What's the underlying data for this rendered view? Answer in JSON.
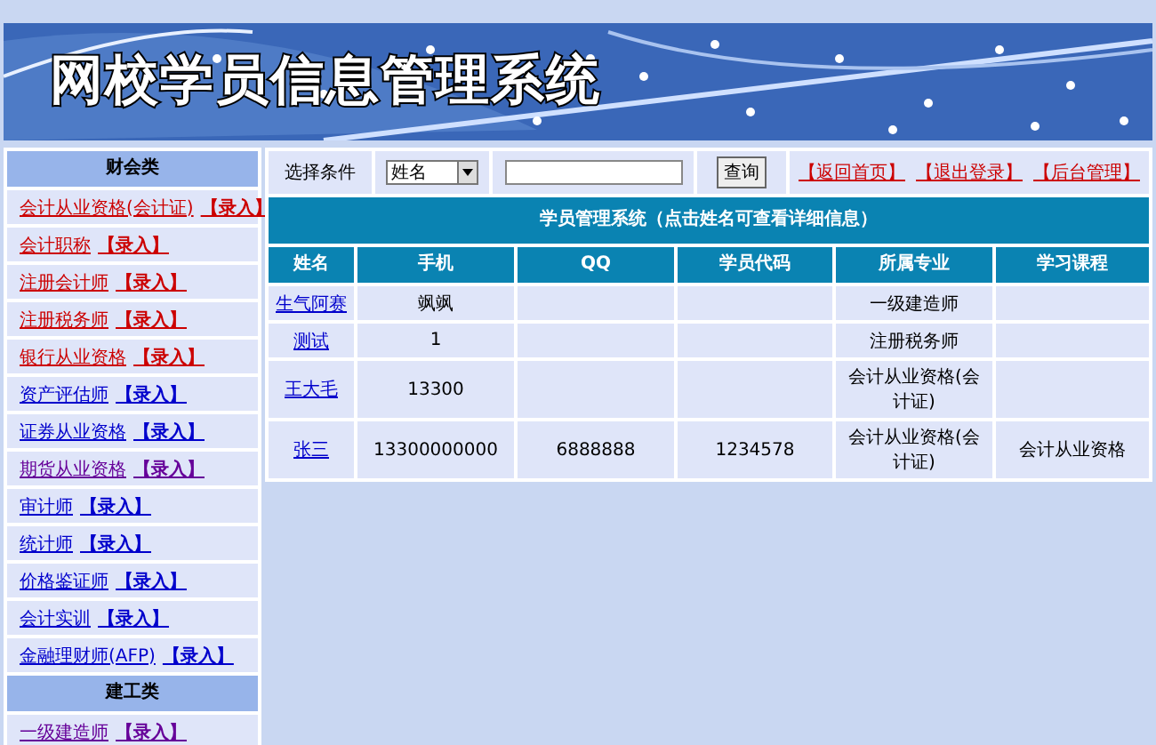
{
  "banner": {
    "title": "网校学员信息管理系统"
  },
  "sidebar": {
    "sections": [
      {
        "heading": "财会类",
        "items": [
          {
            "label": "会计从业资格(会计证)",
            "action": "【录入】",
            "color": "#cc0000"
          },
          {
            "label": "会计职称",
            "action": "【录入】",
            "color": "#cc0000"
          },
          {
            "label": "注册会计师",
            "action": "【录入】",
            "color": "#cc0000"
          },
          {
            "label": "注册税务师",
            "action": "【录入】",
            "color": "#cc0000"
          },
          {
            "label": "银行从业资格",
            "action": "【录入】",
            "color": "#cc0000"
          },
          {
            "label": "资产评估师",
            "action": "【录入】",
            "color": "#0000cc"
          },
          {
            "label": "证券从业资格",
            "action": "【录入】",
            "color": "#0000cc"
          },
          {
            "label": "期货从业资格",
            "action": "【录入】",
            "color": "#660099"
          },
          {
            "label": "审计师",
            "action": "【录入】",
            "color": "#0000cc"
          },
          {
            "label": "统计师",
            "action": "【录入】",
            "color": "#0000cc"
          },
          {
            "label": "价格鉴证师",
            "action": "【录入】",
            "color": "#0000cc"
          },
          {
            "label": "会计实训",
            "action": "【录入】",
            "color": "#0000cc"
          },
          {
            "label": "金融理财师(AFP)",
            "action": "【录入】",
            "color": "#0000cc"
          }
        ]
      },
      {
        "heading": "建工类",
        "items": [
          {
            "label": "一级建造师",
            "action": "【录入】",
            "color": "#660099"
          }
        ]
      }
    ]
  },
  "search": {
    "label": "选择条件",
    "select": "姓名",
    "button": "查询",
    "links": [
      "【返回首页】",
      "【退出登录】",
      "【后台管理】"
    ]
  },
  "table": {
    "caption": "学员管理系统（点击姓名可查看详细信息）",
    "columns": [
      "姓名",
      "手机",
      "QQ",
      "学员代码",
      "所属专业",
      "学习课程"
    ],
    "rows": [
      [
        "生气阿赛",
        "飒飒",
        "",
        "",
        "一级建造师",
        ""
      ],
      [
        "测试",
        "1",
        "",
        "",
        "注册税务师",
        ""
      ],
      [
        "王大毛",
        "13300",
        "",
        "",
        "会计从业资格(会计证)",
        ""
      ],
      [
        "张三",
        "13300000000",
        "6888888",
        "1234578",
        "会计从业资格(会计证)",
        "会计从业资格"
      ]
    ]
  }
}
